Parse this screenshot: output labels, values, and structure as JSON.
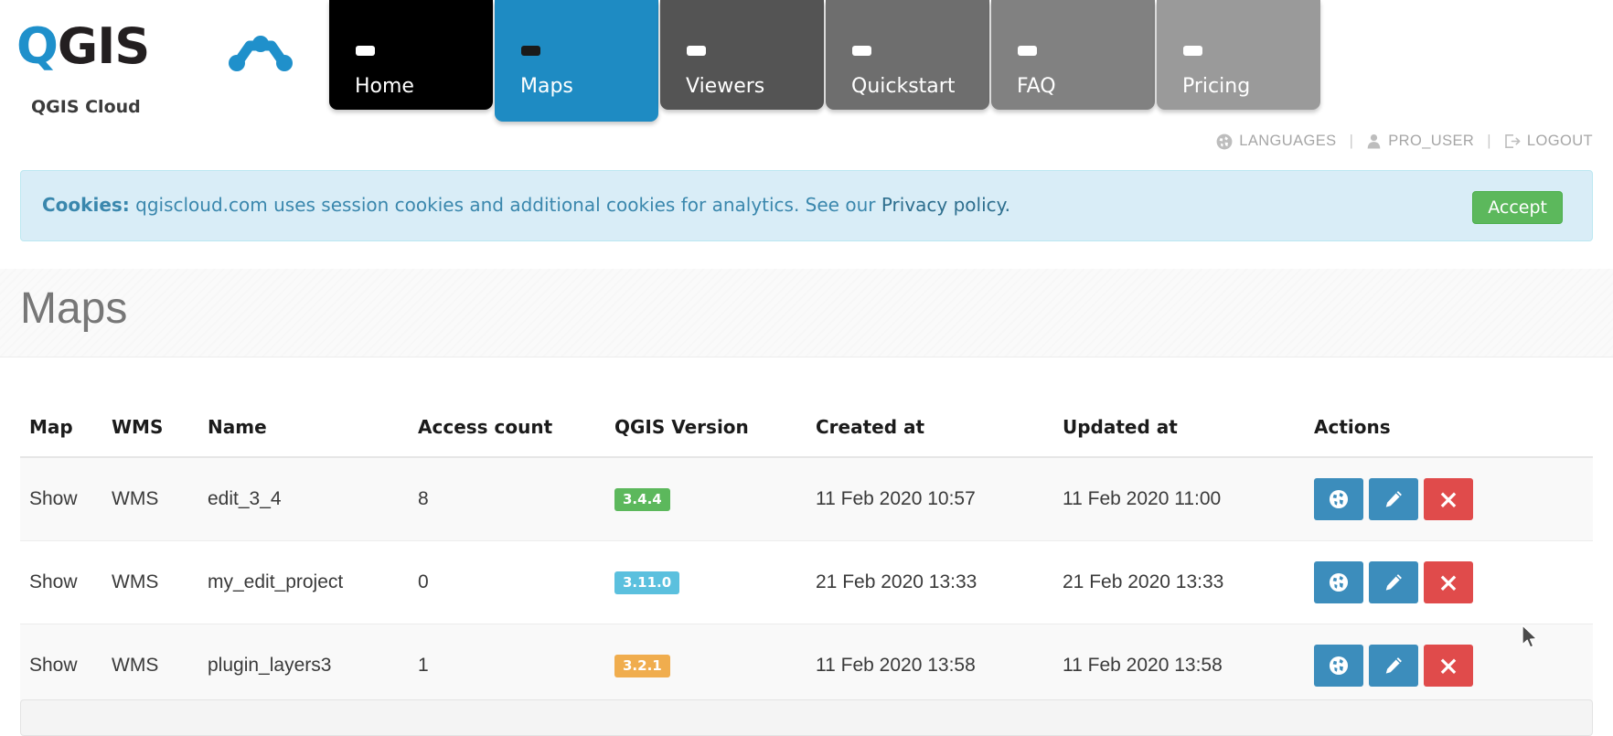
{
  "brand": {
    "word_q": "Q",
    "word_rest": "GIS",
    "subtitle": "QGIS Cloud"
  },
  "nav": {
    "tabs": [
      {
        "label": "Home",
        "bg": "#000000",
        "active": false
      },
      {
        "label": "Maps",
        "bg": "#1e8bc3",
        "active": true
      },
      {
        "label": "Viewers",
        "bg": "#545454",
        "active": false
      },
      {
        "label": "Quickstart",
        "bg": "#6e6e6e",
        "active": false
      },
      {
        "label": "FAQ",
        "bg": "#818181",
        "active": false
      },
      {
        "label": "Pricing",
        "bg": "#9a9a9a",
        "active": false
      }
    ]
  },
  "userbar": {
    "languages": "LANGUAGES",
    "user": "PRO_USER",
    "logout": "LOGOUT",
    "separator": "|"
  },
  "cookie": {
    "label": "Cookies:",
    "message": " qgiscloud.com uses session cookies and additional cookies for analytics. See our ",
    "link": "Privacy policy.",
    "accept_label": "Accept"
  },
  "page": {
    "title": "Maps"
  },
  "table": {
    "columns": [
      "Map",
      "WMS",
      "Name",
      "Access count",
      "QGIS Version",
      "Created at",
      "Updated at",
      "Actions"
    ],
    "rows": [
      {
        "map": "Show",
        "wms": "WMS",
        "name": "edit_3_4",
        "access_count": "8",
        "version": "3.4.4",
        "version_color": "#5cb85c",
        "created_at": "11 Feb 2020 10:57",
        "updated_at": "11 Feb 2020 11:00"
      },
      {
        "map": "Show",
        "wms": "WMS",
        "name": "my_edit_project",
        "access_count": "0",
        "version": "3.11.0",
        "version_color": "#5bc0de",
        "created_at": "21 Feb 2020 13:33",
        "updated_at": "21 Feb 2020 13:33"
      },
      {
        "map": "Show",
        "wms": "WMS",
        "name": "plugin_layers3",
        "access_count": "1",
        "version": "3.2.1",
        "version_color": "#f0ad4e",
        "created_at": "11 Feb 2020 13:58",
        "updated_at": "11 Feb 2020 13:58"
      }
    ],
    "action_icons": [
      "globe-icon",
      "pencil-icon",
      "close-icon"
    ]
  },
  "colors": {
    "accent": "#1e8bc3",
    "danger": "#e04b4b",
    "action_blue": "#3c8dbc"
  }
}
